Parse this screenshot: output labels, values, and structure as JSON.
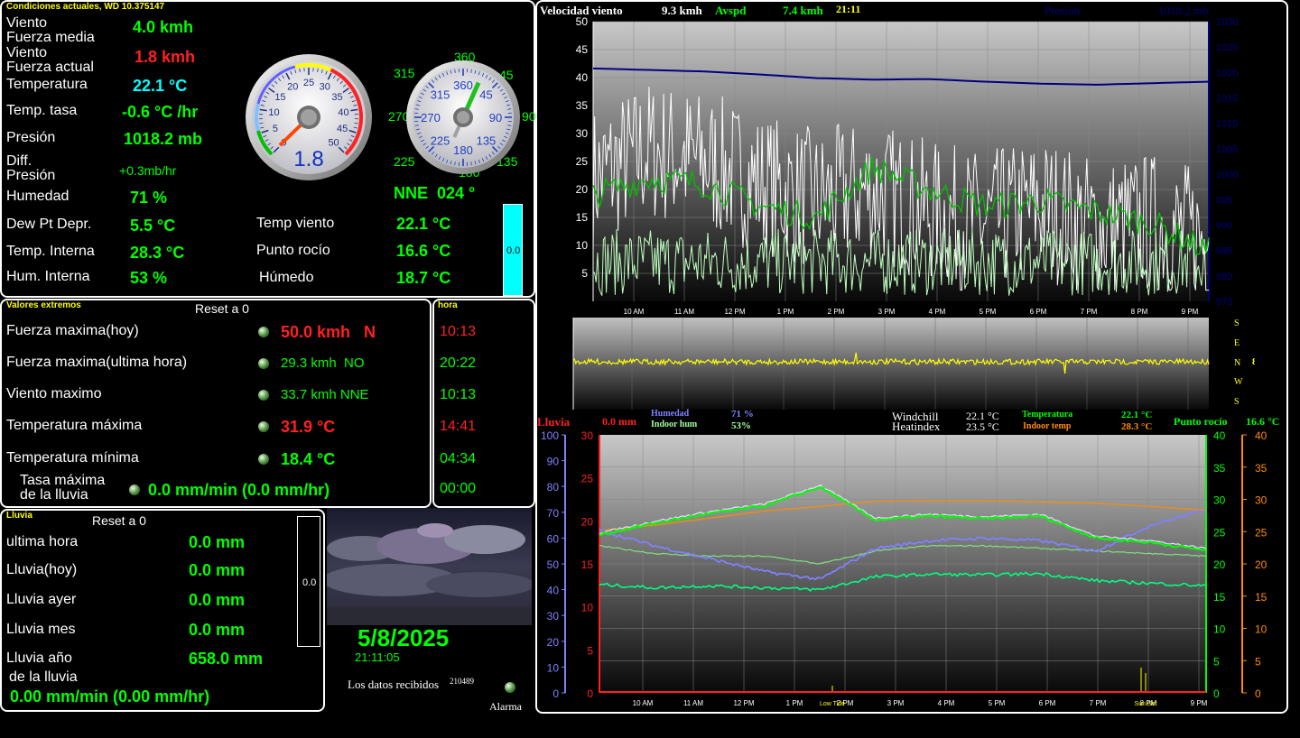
{
  "current": {
    "title": "Condiciones actuales, WD 10.375147",
    "rows": [
      {
        "label": "Viento\nFuerza media",
        "value": "4.0 kmh",
        "color": "#00ff00"
      },
      {
        "label": "Viento\nFuerza actual",
        "value": "1.8 kmh",
        "color": "#ff2020"
      },
      {
        "label": "Temperatura",
        "value": "22.1 °C",
        "color": "#00ffff"
      },
      {
        "label": "Temp. tasa",
        "value": "-0.6 °C /hr",
        "color": "#00ff00"
      },
      {
        "label": "Presión",
        "value": "1018.2 mb",
        "color": "#00ff00"
      },
      {
        "label": "Diff.\nPresión",
        "value": "+0.3mb/hr",
        "color": "#00ff00"
      },
      {
        "label": "Humedad",
        "value": "71 %",
        "color": "#00ff00"
      },
      {
        "label": "Dew Pt Depr.",
        "value": "5.5 °C",
        "color": "#00ff00"
      },
      {
        "label": "Temp. Interna",
        "value": "28.3 °C",
        "color": "#00ff00"
      },
      {
        "label": "Hum. Interna",
        "value": "53 %",
        "color": "#00ff00"
      }
    ],
    "right_rows": [
      {
        "label": "Temp viento",
        "value": "22.1 °C"
      },
      {
        "label": "Punto rocío",
        "value": "16.6 °C"
      },
      {
        "label": "Húmedo",
        "value": "18.7 °C"
      }
    ],
    "speed_gauge": {
      "value": "1.8",
      "ticks": [
        "0",
        "5",
        "10",
        "15",
        "20",
        "25",
        "30",
        "35",
        "40",
        "45",
        "50"
      ]
    },
    "compass": {
      "heading_text": "NNE  024 °",
      "heading_deg": 24,
      "inner_ticks": [
        "360",
        "45",
        "90",
        "135",
        "180",
        "225",
        "270",
        "315"
      ],
      "outer_labels": [
        "360",
        "45",
        "90",
        "135",
        "180",
        "225",
        "270",
        "315"
      ]
    },
    "cyan_bar_value": "0.0"
  },
  "extremes": {
    "title": "Valores extremos",
    "reset_label": "Reset a 0",
    "hour_title": "hora",
    "rows": [
      {
        "label": "Fuerza maxima(hoy)",
        "value": "50.0 kmh   N",
        "time": "10:13",
        "value_color": "#ff2020",
        "time_color": "#ff2020"
      },
      {
        "label": "Fuerza maxima(ultima hora)",
        "value": "29.3 kmh  NO",
        "time": "20:22",
        "value_color": "#00ff00",
        "time_color": "#00ff00"
      },
      {
        "label": "Viento maximo",
        "value": "33.7 kmh NNE",
        "time": "10:13",
        "value_color": "#00ff00",
        "time_color": "#00ff00"
      },
      {
        "label": "Temperatura máxima",
        "value": "31.9 °C",
        "time": "14:41",
        "value_color": "#ff2020",
        "time_color": "#ff2020"
      },
      {
        "label": "Temperatura mínima",
        "value": "18.4 °C",
        "time": "04:34",
        "value_color": "#00ff00",
        "time_color": "#00ff00"
      },
      {
        "label": "Tasa máxima\nde la lluvia",
        "value": "0.0 mm/min (0.0 mm/hr)",
        "time": "00:00",
        "value_color": "#00ff00",
        "time_color": "#00ff00"
      }
    ]
  },
  "rain": {
    "title": "Lluvia",
    "reset_label": "Reset a 0",
    "rows": [
      {
        "label": "ultima hora",
        "value": "0.0 mm"
      },
      {
        "label": "Lluvia(hoy)",
        "value": "0.0 mm"
      },
      {
        "label": "Lluvia ayer",
        "value": "0.0 mm"
      },
      {
        "label": "Lluvia mes",
        "value": "0.0 mm"
      },
      {
        "label": "Lluvia año",
        "value": "658.0 mm"
      }
    ],
    "rate_label": "de la lluvia",
    "rate_value": "0.00 mm/min (0.00 mm/hr)",
    "bar_value": "0.0"
  },
  "status": {
    "date": "5/8/2025",
    "time": "21:11:05",
    "received_label": "Los datos recibidos",
    "received_count": "210489",
    "alarm_label": "Alarma"
  },
  "colors": {
    "green": "#00ff00",
    "red": "#ff2020",
    "cyan": "#00ffff",
    "yellow": "#ffff00",
    "navy": "#000080",
    "orange": "#ff8c00",
    "purple": "#8080ff",
    "mint": "#66ff99"
  },
  "wind_chart": {
    "title": "Velocidad viento",
    "speed_value": "9.3 kmh",
    "avspd_label": "Avspd",
    "avspd_value": "7.4 kmh",
    "time_label": "21:11",
    "pressure_label": "Presión",
    "pressure_value": "1018.2 mb",
    "x_labels": [
      "10 AM",
      "11 AM",
      "12 PM",
      "1 PM",
      "2 PM",
      "3 PM",
      "4 PM",
      "5 PM",
      "6 PM",
      "7 PM",
      "8 PM",
      "9 PM"
    ],
    "y_left": [
      "50",
      "45",
      "40",
      "35",
      "30",
      "25",
      "20",
      "15",
      "10",
      "5"
    ],
    "y_right": [
      "1030",
      "1025",
      "1020",
      "1015",
      "1010",
      "1005",
      "1000",
      "995",
      "990",
      "985",
      "980",
      "975"
    ],
    "dir_labels": [
      "S",
      "E",
      "N",
      "W",
      "S"
    ],
    "dir_value": "8"
  },
  "chart_data": [
    {
      "type": "line",
      "title": "Velocidad viento",
      "x": [
        "10 AM",
        "11 AM",
        "12 PM",
        "1 PM",
        "2 PM",
        "3 PM",
        "4 PM",
        "5 PM",
        "6 PM",
        "7 PM",
        "8 PM",
        "9 PM"
      ],
      "ylim": [
        0,
        50
      ],
      "series": [
        {
          "name": "Velocidad viento",
          "values": [
            22,
            27,
            25,
            21,
            18,
            20,
            16,
            14,
            17,
            13,
            14,
            11
          ]
        },
        {
          "name": "Avspd",
          "values": [
            19,
            22,
            21,
            17,
            15,
            24,
            20,
            17,
            18,
            16,
            14,
            9
          ]
        },
        {
          "name": "Presión",
          "values": [
            1020.8,
            1020.5,
            1020.2,
            1019.6,
            1018.9,
            1018.6,
            1018.7,
            1018.2,
            1017.8,
            1017.6,
            1017.9,
            1018.2
          ]
        }
      ],
      "y2lim": [
        975,
        1030
      ]
    },
    {
      "type": "line",
      "title": "Lluvia",
      "x": [
        "10 AM",
        "11 AM",
        "12 PM",
        "1 PM",
        "2 PM",
        "3 PM",
        "4 PM",
        "5 PM",
        "6 PM",
        "7 PM",
        "8 PM",
        "9 PM"
      ],
      "series": [
        {
          "name": "Humedad",
          "values": [
            63,
            57,
            52,
            47,
            44,
            56,
            59,
            60,
            59,
            55,
            65,
            71
          ]
        },
        {
          "name": "Temperatura",
          "values": [
            24.5,
            26.3,
            27.8,
            29.0,
            31.9,
            26.8,
            27.4,
            27.0,
            27.4,
            24.0,
            23.3,
            22.1
          ]
        },
        {
          "name": "Indoor temp",
          "values": [
            25.2,
            26.0,
            27.1,
            28.2,
            28.9,
            29.7,
            29.8,
            29.8,
            29.6,
            29.4,
            28.9,
            28.3
          ]
        },
        {
          "name": "Punto rocío",
          "values": [
            16.8,
            16.3,
            16.6,
            16.3,
            16.0,
            18.0,
            18.4,
            18.3,
            18.5,
            17.4,
            17.0,
            16.6
          ]
        },
        {
          "name": "Indoor hum",
          "values": [
            57,
            54,
            53,
            53,
            50,
            55,
            57,
            57,
            56,
            55,
            54,
            53
          ]
        }
      ],
      "ylim": [
        0,
        30
      ],
      "legend": {
        "rain_label": "Lluvia",
        "rain_value": "0.0 mm",
        "hum_label": "Humedad",
        "hum_value": "71 %",
        "indoor_hum_label": "Indoor hum",
        "indoor_hum_value": "53%",
        "windchill_label": "Windchill",
        "windchill_value": "22.1 °C",
        "heatindex_label": "Heatindex",
        "heatindex_value": "23.5 °C",
        "temp_label": "Temperatura",
        "temp_value": "22.1 °C",
        "indoor_temp_label": "Indoor temp",
        "indoor_temp_value": "28.3 °C",
        "dew_label": "Punto rocío",
        "dew_value": "16.6 °C"
      },
      "y_axes": {
        "humidity": [
          "100",
          "90",
          "80",
          "70",
          "60",
          "50",
          "40",
          "30",
          "20",
          "10",
          "0"
        ],
        "rain": [
          "30",
          "25",
          "20",
          "15",
          "10",
          "5",
          "0"
        ],
        "temp": [
          "40",
          "35",
          "30",
          "25",
          "20",
          "15",
          "10",
          "5",
          "0"
        ],
        "indoor": [
          "40",
          "35",
          "30",
          "25",
          "20",
          "15",
          "10",
          "5",
          "0"
        ]
      },
      "markers": [
        "Low Tide",
        "Sun Set"
      ]
    }
  ]
}
